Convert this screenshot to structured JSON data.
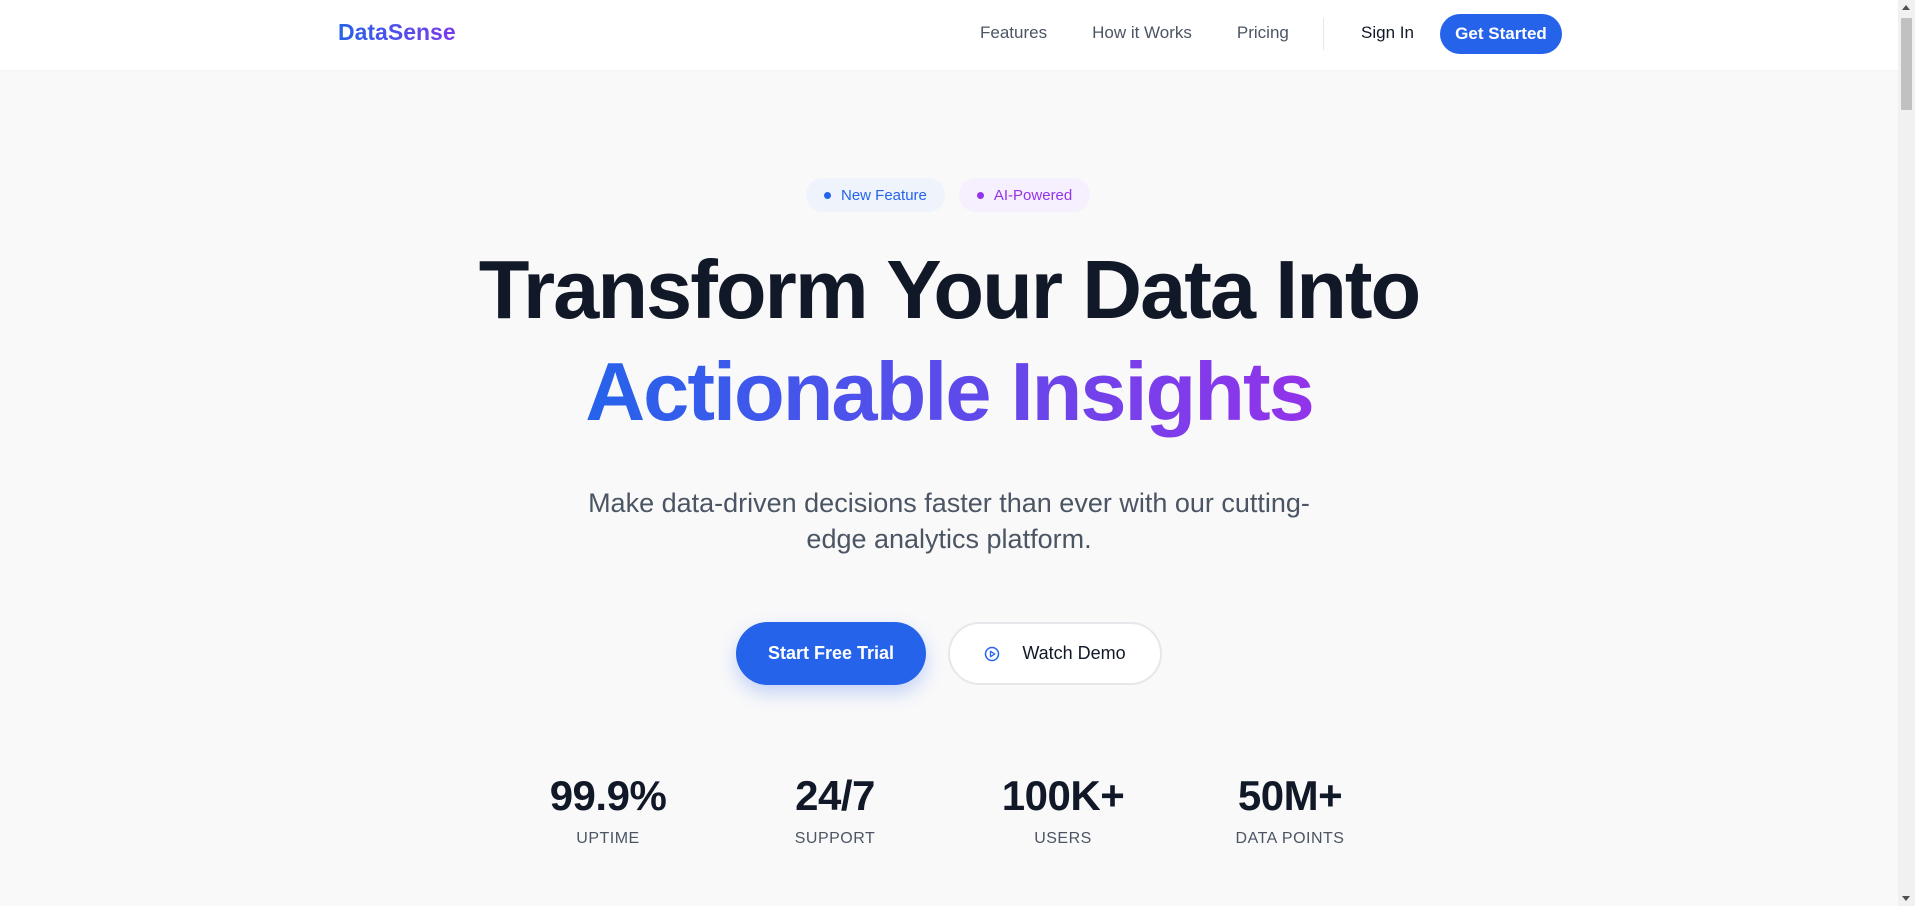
{
  "nav": {
    "logo": "DataSense",
    "links": [
      "Features",
      "How it Works",
      "Pricing"
    ],
    "sign_in": "Sign In",
    "get_started": "Get Started"
  },
  "badges": [
    "New Feature",
    "AI-Powered"
  ],
  "hero": {
    "line1": "Transform Your Data Into",
    "line2": "Actionable Insights",
    "subtitle": "Make data-driven decisions faster than ever with our cutting-edge analytics platform."
  },
  "cta": {
    "primary": "Start Free Trial",
    "secondary": "Watch Demo"
  },
  "stats": [
    {
      "value": "99.9%",
      "label": "UPTIME"
    },
    {
      "value": "24/7",
      "label": "SUPPORT"
    },
    {
      "value": "100K+",
      "label": "USERS"
    },
    {
      "value": "50M+",
      "label": "DATA POINTS"
    }
  ],
  "colors": {
    "primary": "#2563eb",
    "accent": "#9333ea",
    "text": "#111827",
    "muted": "#4b5563"
  }
}
